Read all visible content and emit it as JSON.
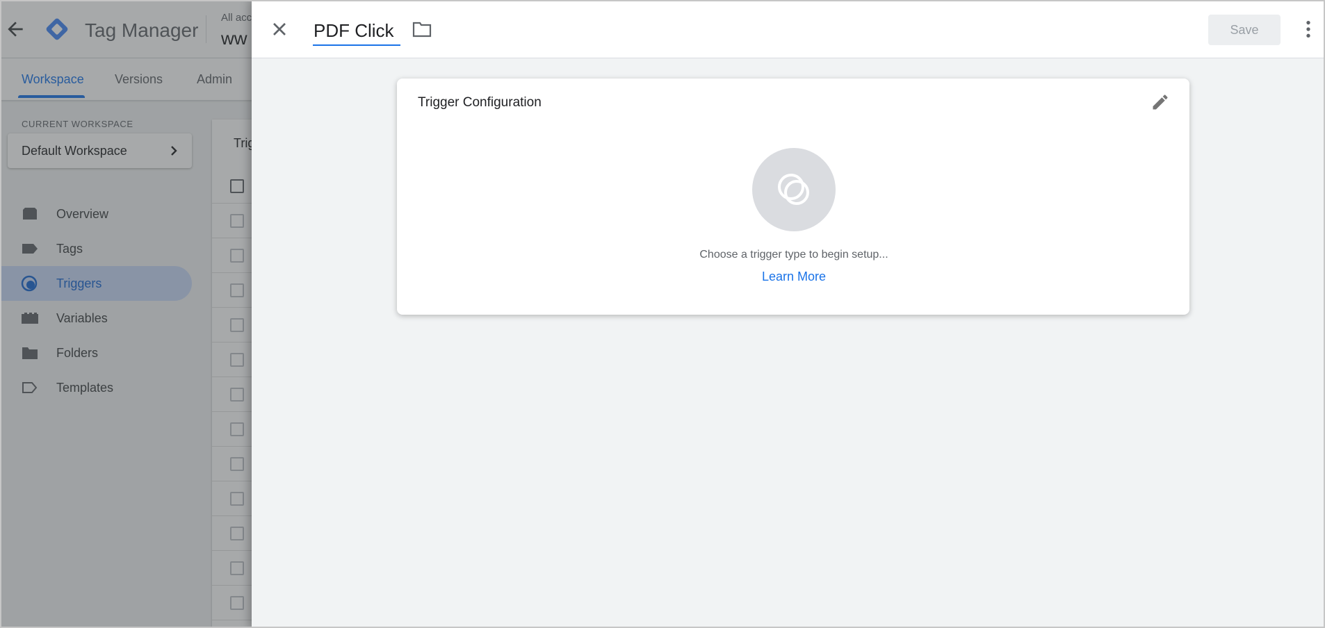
{
  "app": {
    "brand": "Tag Manager",
    "account_crumb": "All acc",
    "container_name": "ww"
  },
  "tabs": [
    {
      "label": "Workspace",
      "active": true
    },
    {
      "label": "Versions",
      "active": false
    },
    {
      "label": "Admin",
      "active": false
    }
  ],
  "sidebar": {
    "current_workspace_label": "CURRENT WORKSPACE",
    "workspace_name": "Default Workspace",
    "items": [
      {
        "label": "Overview",
        "icon": "overview-icon",
        "active": false
      },
      {
        "label": "Tags",
        "icon": "tag-icon",
        "active": false
      },
      {
        "label": "Triggers",
        "icon": "trigger-icon",
        "active": true
      },
      {
        "label": "Variables",
        "icon": "variables-icon",
        "active": false
      },
      {
        "label": "Folders",
        "icon": "folder-icon",
        "active": false
      },
      {
        "label": "Templates",
        "icon": "template-icon",
        "active": false
      }
    ]
  },
  "list": {
    "title_fragment": "Trig"
  },
  "panel": {
    "name_value": "PDF Click",
    "save_label": "Save",
    "config": {
      "title": "Trigger Configuration",
      "hint": "Choose a trigger type to begin setup...",
      "learn_more": "Learn More"
    }
  },
  "colors": {
    "accent": "#1a73e8",
    "nav_active_bg": "#c8d9f8",
    "brand_blue": "#4285f4",
    "brand_dark_blue": "#246fdb"
  }
}
